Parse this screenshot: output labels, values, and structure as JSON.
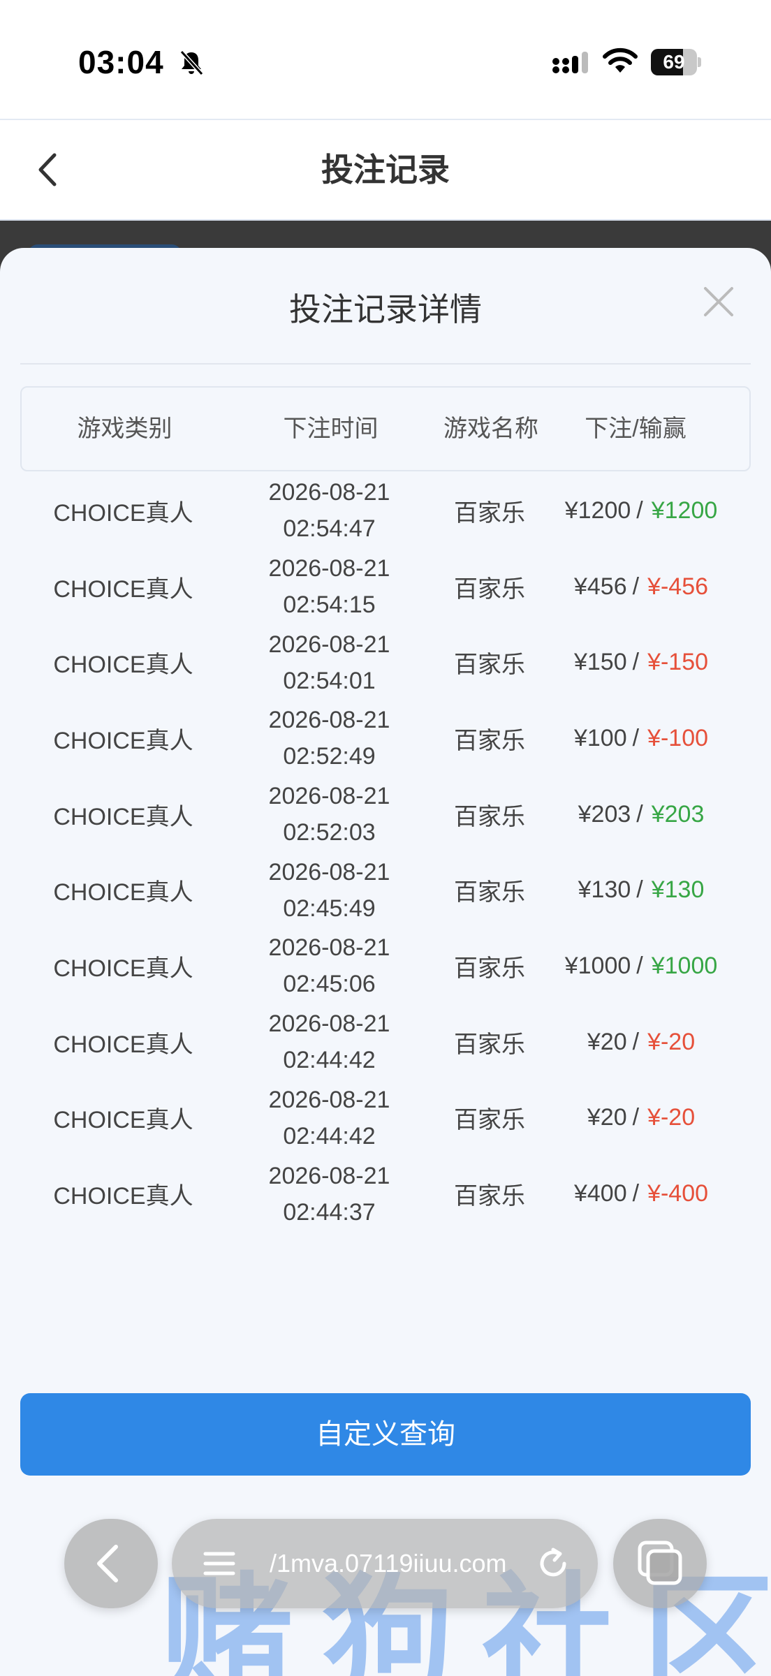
{
  "status_bar": {
    "time": "03:04",
    "battery": "69",
    "battery_level": 0.69
  },
  "header": {
    "title": "投注记录"
  },
  "modal": {
    "title": "投注记录详情",
    "columns": [
      "游戏类别",
      "下注时间",
      "游戏名称",
      "下注/输赢"
    ],
    "rows": [
      {
        "category": "CHOICE真人",
        "date": "2026-08-21",
        "time": "02:54:47",
        "game": "百家乐",
        "bet": "¥1200",
        "result": "¥1200",
        "result_type": "win"
      },
      {
        "category": "CHOICE真人",
        "date": "2026-08-21",
        "time": "02:54:15",
        "game": "百家乐",
        "bet": "¥456",
        "result": "¥-456",
        "result_type": "loss"
      },
      {
        "category": "CHOICE真人",
        "date": "2026-08-21",
        "time": "02:54:01",
        "game": "百家乐",
        "bet": "¥150",
        "result": "¥-150",
        "result_type": "loss"
      },
      {
        "category": "CHOICE真人",
        "date": "2026-08-21",
        "time": "02:52:49",
        "game": "百家乐",
        "bet": "¥100",
        "result": "¥-100",
        "result_type": "loss"
      },
      {
        "category": "CHOICE真人",
        "date": "2026-08-21",
        "time": "02:52:03",
        "game": "百家乐",
        "bet": "¥203",
        "result": "¥203",
        "result_type": "win"
      },
      {
        "category": "CHOICE真人",
        "date": "2026-08-21",
        "time": "02:45:49",
        "game": "百家乐",
        "bet": "¥130",
        "result": "¥130",
        "result_type": "win"
      },
      {
        "category": "CHOICE真人",
        "date": "2026-08-21",
        "time": "02:45:06",
        "game": "百家乐",
        "bet": "¥1000",
        "result": "¥1000",
        "result_type": "win"
      },
      {
        "category": "CHOICE真人",
        "date": "2026-08-21",
        "time": "02:44:42",
        "game": "百家乐",
        "bet": "¥20",
        "result": "¥-20",
        "result_type": "loss"
      },
      {
        "category": "CHOICE真人",
        "date": "2026-08-21",
        "time": "02:44:42",
        "game": "百家乐",
        "bet": "¥20",
        "result": "¥-20",
        "result_type": "loss"
      },
      {
        "category": "CHOICE真人",
        "date": "2026-08-21",
        "time": "02:44:37",
        "game": "百家乐",
        "bet": "¥400",
        "result": "¥-400",
        "result_type": "loss"
      }
    ],
    "query_button": "自定义查询"
  },
  "browser": {
    "url": "/1mva.07119iiuu.com"
  },
  "watermark": "赌狗社区",
  "colors": {
    "win": "#37a645",
    "loss": "#e6503a",
    "primary": "#2f88e6"
  }
}
